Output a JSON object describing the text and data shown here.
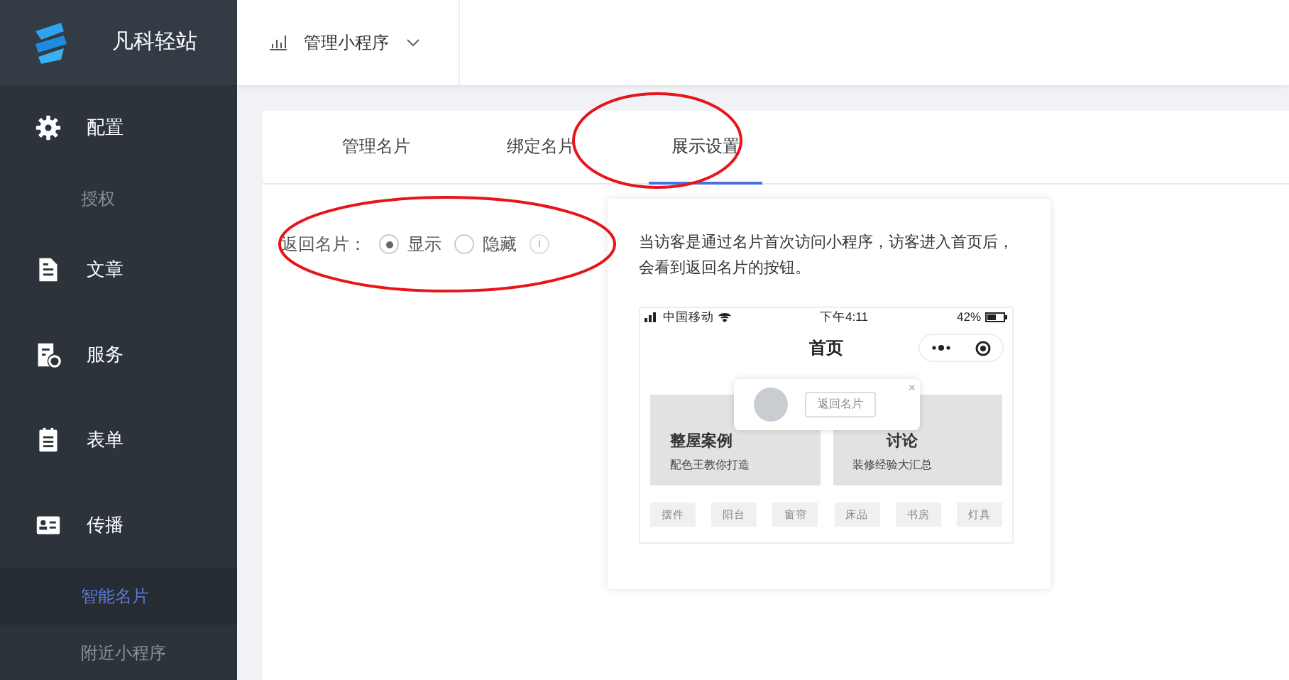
{
  "brand": {
    "name": "凡科轻站"
  },
  "topbar": {
    "app_selector": "管理小程序"
  },
  "sidebar": {
    "items": [
      {
        "label": "配置",
        "children": [
          {
            "label": "授权",
            "selected": false
          }
        ]
      },
      {
        "label": "文章"
      },
      {
        "label": "服务"
      },
      {
        "label": "表单"
      },
      {
        "label": "传播",
        "children": [
          {
            "label": "智能名片",
            "selected": true
          },
          {
            "label": "附近小程序",
            "selected": false
          }
        ]
      }
    ]
  },
  "tabs": [
    {
      "label": "管理名片",
      "selected": false
    },
    {
      "label": "绑定名片",
      "selected": false
    },
    {
      "label": "展示设置",
      "selected": true
    }
  ],
  "setting": {
    "label": "返回名片：",
    "options": [
      {
        "label": "显示",
        "selected": true
      },
      {
        "label": "隐藏",
        "selected": false
      }
    ],
    "info_icon": "i"
  },
  "preview": {
    "description": "当访客是通过名片首次访问小程序，访客进入首页后，会看到返回名片的按钮。",
    "phone": {
      "carrier": "中国移动",
      "time": "下午4:11",
      "battery": "42%",
      "page_title": "首页",
      "popup_button": "返回名片",
      "popup_close": "×",
      "banners": [
        {
          "title": "整屋案例",
          "subtitle": "配色王教你打造"
        },
        {
          "title": "讨论",
          "subtitle": "装修经验大汇总"
        }
      ],
      "tags": [
        "摆件",
        "阳台",
        "窗帘",
        "床品",
        "书房",
        "灯具"
      ]
    }
  }
}
